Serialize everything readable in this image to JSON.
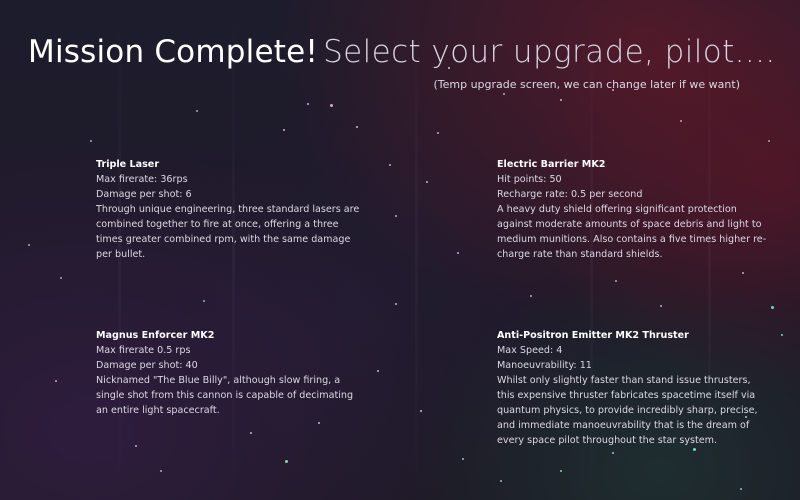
{
  "header": {
    "title": "Mission Complete!",
    "subtitle": "Select your upgrade, pilot....",
    "note": "(Temp upgrade screen, we can change later if we want)"
  },
  "upgrades": [
    {
      "name": "Triple Laser",
      "stats": [
        "Max firerate: 36rps",
        "Damage per shot: 6"
      ],
      "description": "Through unique engineering, three standard lasers are combined together to fire at once, offering a three times greater combined rpm, with the same damage per bullet."
    },
    {
      "name": "Electric Barrier MK2",
      "stats": [
        "Hit points: 50",
        "Recharge rate: 0.5 per second"
      ],
      "description": "A heavy duty shield offering significant protection against moderate amounts of space debris and light to medium munitions. Also contains a five times higher re-charge rate than standard shields."
    },
    {
      "name": "Magnus Enforcer MK2",
      "stats": [
        "Max firerate 0.5 rps",
        "Damage per shot: 40"
      ],
      "description": "Nicknamed \"The Blue Billy\", although slow firing, a single shot from this cannon is capable of decimating an entire light spacecraft."
    },
    {
      "name": "Anti-Positron Emitter MK2 Thruster",
      "stats": [
        "Max Speed: 4",
        "Manoeuvrability: 11"
      ],
      "description": "Whilst only slightly faster than stand issue thrusters, this expensive thruster fabricates spacetime itself via quantum physics, to provide incredibly sharp, precise, and immediate manoeuvrability that is the dream of every space pilot throughout the star system."
    }
  ],
  "colors": {
    "background": "#1e1a28",
    "title": "#ffffff",
    "text": "#dcd8e4"
  }
}
